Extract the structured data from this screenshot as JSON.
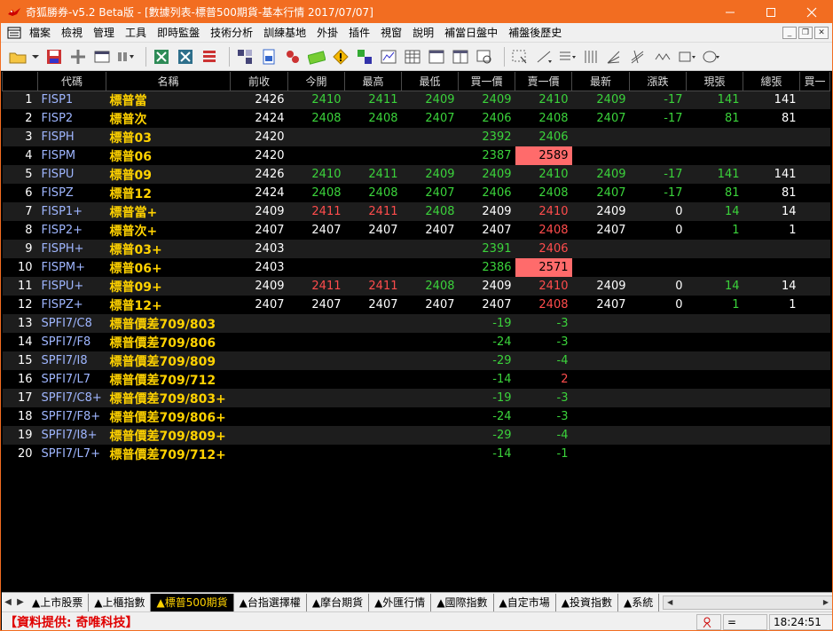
{
  "window": {
    "title": "奇狐勝券-v5.2 Beta版 - [數據列表-標普500期貨-基本行情 2017/07/07]",
    "accent": "#f26d21"
  },
  "menu": [
    "檔案",
    "檢視",
    "管理",
    "工具",
    "即時監盤",
    "技術分析",
    "訓練基地",
    "外掛",
    "插件",
    "視窗",
    "說明",
    "補當日盤中",
    "補盤後歷史"
  ],
  "table": {
    "headers": [
      "代碼",
      "名稱",
      "前收",
      "今開",
      "最高",
      "最低",
      "買一價",
      "賣一價",
      "最新",
      "漲跌",
      "現張",
      "總張",
      "買一"
    ],
    "rows": [
      {
        "idx": "1",
        "code": "FISP1",
        "name": "標普當",
        "prev": "2426",
        "open": "2410",
        "high": "2411",
        "low": "2409",
        "bid": "2409",
        "ask": "2410",
        "last": "2409",
        "chg": "-17",
        "vol": "141",
        "total": "141",
        "c": [
          "w",
          "g",
          "g",
          "g",
          "g",
          "g",
          "g",
          "g",
          "g",
          "w"
        ],
        "hl": false
      },
      {
        "idx": "2",
        "code": "FISP2",
        "name": "標普次",
        "prev": "2424",
        "open": "2408",
        "high": "2408",
        "low": "2407",
        "bid": "2406",
        "ask": "2408",
        "last": "2407",
        "chg": "-17",
        "vol": "81",
        "total": "81",
        "c": [
          "w",
          "g",
          "g",
          "g",
          "g",
          "g",
          "g",
          "g",
          "g",
          "w"
        ],
        "hl": false
      },
      {
        "idx": "3",
        "code": "FISPH",
        "name": "標普03",
        "prev": "2420",
        "open": "",
        "high": "",
        "low": "",
        "bid": "2392",
        "ask": "2406",
        "last": "",
        "chg": "",
        "vol": "",
        "total": "",
        "c": [
          "w",
          "g",
          "g",
          "g",
          "g",
          "g",
          "g",
          "g",
          "g",
          "w"
        ],
        "hl": false
      },
      {
        "idx": "4",
        "code": "FISPM",
        "name": "標普06",
        "prev": "2420",
        "open": "",
        "high": "",
        "low": "",
        "bid": "2387",
        "ask": "2589",
        "last": "",
        "chg": "",
        "vol": "",
        "total": "",
        "c": [
          "w",
          "g",
          "g",
          "g",
          "g",
          "w",
          "g",
          "g",
          "g",
          "w"
        ],
        "hl": true
      },
      {
        "idx": "5",
        "code": "FISPU",
        "name": "標普09",
        "prev": "2426",
        "open": "2410",
        "high": "2411",
        "low": "2409",
        "bid": "2409",
        "ask": "2410",
        "last": "2409",
        "chg": "-17",
        "vol": "141",
        "total": "141",
        "c": [
          "w",
          "g",
          "g",
          "g",
          "g",
          "g",
          "g",
          "g",
          "g",
          "w"
        ],
        "hl": false
      },
      {
        "idx": "6",
        "code": "FISPZ",
        "name": "標普12",
        "prev": "2424",
        "open": "2408",
        "high": "2408",
        "low": "2407",
        "bid": "2406",
        "ask": "2408",
        "last": "2407",
        "chg": "-17",
        "vol": "81",
        "total": "81",
        "c": [
          "w",
          "g",
          "g",
          "g",
          "g",
          "g",
          "g",
          "g",
          "g",
          "w"
        ],
        "hl": false
      },
      {
        "idx": "7",
        "code": "FISP1+",
        "name": "標普當+",
        "prev": "2409",
        "open": "2411",
        "high": "2411",
        "low": "2408",
        "bid": "2409",
        "ask": "2410",
        "last": "2409",
        "chg": "0",
        "vol": "14",
        "total": "14",
        "c": [
          "w",
          "r",
          "r",
          "g",
          "w",
          "r",
          "w",
          "w",
          "g",
          "w"
        ],
        "hl": false
      },
      {
        "idx": "8",
        "code": "FISP2+",
        "name": "標普次+",
        "prev": "2407",
        "open": "2407",
        "high": "2407",
        "low": "2407",
        "bid": "2407",
        "ask": "2408",
        "last": "2407",
        "chg": "0",
        "vol": "1",
        "total": "1",
        "c": [
          "w",
          "w",
          "w",
          "w",
          "w",
          "r",
          "w",
          "w",
          "g",
          "w"
        ],
        "hl": false
      },
      {
        "idx": "9",
        "code": "FISPH+",
        "name": "標普03+",
        "prev": "2403",
        "open": "",
        "high": "",
        "low": "",
        "bid": "2391",
        "ask": "2406",
        "last": "",
        "chg": "",
        "vol": "",
        "total": "",
        "c": [
          "w",
          "g",
          "g",
          "g",
          "g",
          "r",
          "g",
          "g",
          "g",
          "w"
        ],
        "hl": false
      },
      {
        "idx": "10",
        "code": "FISPM+",
        "name": "標普06+",
        "prev": "2403",
        "open": "",
        "high": "",
        "low": "",
        "bid": "2386",
        "ask": "2571",
        "last": "",
        "chg": "",
        "vol": "",
        "total": "",
        "c": [
          "w",
          "g",
          "g",
          "g",
          "g",
          "w",
          "g",
          "g",
          "g",
          "w"
        ],
        "hl": true
      },
      {
        "idx": "11",
        "code": "FISPU+",
        "name": "標普09+",
        "prev": "2409",
        "open": "2411",
        "high": "2411",
        "low": "2408",
        "bid": "2409",
        "ask": "2410",
        "last": "2409",
        "chg": "0",
        "vol": "14",
        "total": "14",
        "c": [
          "w",
          "r",
          "r",
          "g",
          "w",
          "r",
          "w",
          "w",
          "g",
          "w"
        ],
        "hl": false
      },
      {
        "idx": "12",
        "code": "FISPZ+",
        "name": "標普12+",
        "prev": "2407",
        "open": "2407",
        "high": "2407",
        "low": "2407",
        "bid": "2407",
        "ask": "2408",
        "last": "2407",
        "chg": "0",
        "vol": "1",
        "total": "1",
        "c": [
          "w",
          "w",
          "w",
          "w",
          "w",
          "r",
          "w",
          "w",
          "g",
          "w"
        ],
        "hl": false
      },
      {
        "idx": "13",
        "code": "SPFI7/C8",
        "name": "標普價差709/803",
        "prev": "",
        "open": "",
        "high": "",
        "low": "",
        "bid": "-19",
        "ask": "-3",
        "last": "",
        "chg": "",
        "vol": "",
        "total": "",
        "c": [
          "w",
          "g",
          "g",
          "g",
          "g",
          "g",
          "g",
          "g",
          "g",
          "w"
        ],
        "hl": false
      },
      {
        "idx": "14",
        "code": "SPFI7/F8",
        "name": "標普價差709/806",
        "prev": "",
        "open": "",
        "high": "",
        "low": "",
        "bid": "-24",
        "ask": "-3",
        "last": "",
        "chg": "",
        "vol": "",
        "total": "",
        "c": [
          "w",
          "g",
          "g",
          "g",
          "g",
          "g",
          "g",
          "g",
          "g",
          "w"
        ],
        "hl": false
      },
      {
        "idx": "15",
        "code": "SPFI7/I8",
        "name": "標普價差709/809",
        "prev": "",
        "open": "",
        "high": "",
        "low": "",
        "bid": "-29",
        "ask": "-4",
        "last": "",
        "chg": "",
        "vol": "",
        "total": "",
        "c": [
          "w",
          "g",
          "g",
          "g",
          "g",
          "g",
          "g",
          "g",
          "g",
          "w"
        ],
        "hl": false
      },
      {
        "idx": "16",
        "code": "SPFI7/L7",
        "name": "標普價差709/712",
        "prev": "",
        "open": "",
        "high": "",
        "low": "",
        "bid": "-14",
        "ask": "2",
        "last": "",
        "chg": "",
        "vol": "",
        "total": "",
        "c": [
          "w",
          "g",
          "g",
          "g",
          "g",
          "r",
          "g",
          "g",
          "g",
          "w"
        ],
        "hl": false
      },
      {
        "idx": "17",
        "code": "SPFI7/C8+",
        "name": "標普價差709/803+",
        "prev": "",
        "open": "",
        "high": "",
        "low": "",
        "bid": "-19",
        "ask": "-3",
        "last": "",
        "chg": "",
        "vol": "",
        "total": "",
        "c": [
          "w",
          "g",
          "g",
          "g",
          "g",
          "g",
          "g",
          "g",
          "g",
          "w"
        ],
        "hl": false
      },
      {
        "idx": "18",
        "code": "SPFI7/F8+",
        "name": "標普價差709/806+",
        "prev": "",
        "open": "",
        "high": "",
        "low": "",
        "bid": "-24",
        "ask": "-3",
        "last": "",
        "chg": "",
        "vol": "",
        "total": "",
        "c": [
          "w",
          "g",
          "g",
          "g",
          "g",
          "g",
          "g",
          "g",
          "g",
          "w"
        ],
        "hl": false
      },
      {
        "idx": "19",
        "code": "SPFI7/I8+",
        "name": "標普價差709/809+",
        "prev": "",
        "open": "",
        "high": "",
        "low": "",
        "bid": "-29",
        "ask": "-4",
        "last": "",
        "chg": "",
        "vol": "",
        "total": "",
        "c": [
          "w",
          "g",
          "g",
          "g",
          "g",
          "g",
          "g",
          "g",
          "g",
          "w"
        ],
        "hl": false
      },
      {
        "idx": "20",
        "code": "SPFI7/L7+",
        "name": "標普價差709/712+",
        "prev": "",
        "open": "",
        "high": "",
        "low": "",
        "bid": "-14",
        "ask": "-1",
        "last": "",
        "chg": "",
        "vol": "",
        "total": "",
        "c": [
          "w",
          "g",
          "g",
          "g",
          "g",
          "g",
          "g",
          "g",
          "g",
          "w"
        ],
        "hl": false
      }
    ]
  },
  "tabs": [
    "▲上市股票",
    "▲上櫃指數",
    "▲標普500期貨",
    "▲台指選擇權",
    "▲摩台期貨",
    "▲外匯行情",
    "▲國際指數",
    "▲自定市場",
    "▲投資指數",
    "▲系統"
  ],
  "active_tab": 2,
  "status": {
    "provider": "【資料提供: 奇唯科技】",
    "indicator": "=",
    "time": "18:24:51"
  },
  "colors": {
    "up": "#ff4c4c",
    "down": "#3bd33b",
    "flat": "#ffffff",
    "name": "#ffd200",
    "code": "#9fb6ff",
    "highlight": "#ff6b6b"
  }
}
